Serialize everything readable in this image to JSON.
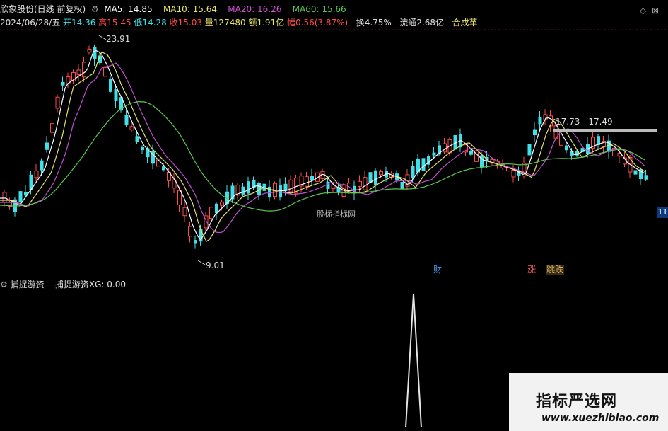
{
  "header": {
    "stock_title": "欣象股份(日线 前复权)",
    "ma5_label": "MA5: 14.85",
    "ma10_label": "MA10: 15.64",
    "ma20_label": "MA20: 16.26",
    "ma60_label": "MA60: 15.66",
    "date": "2024/06/28/五",
    "open": "开14.36",
    "high": "高15.45",
    "low": "低14.28",
    "close": "收15.03",
    "volume": "量127480",
    "amount": "额1.91亿",
    "change": "幅0.56(3.87%)",
    "turnover": "换4.75%",
    "float_cap": "流通2.68亿",
    "concept": "合成革"
  },
  "chart": {
    "peak_label": "23.91",
    "low_label": "9.01",
    "range_label": "17.73 - 17.49",
    "watermark_mid": "股标指标网",
    "tag_cai": "财",
    "tag_zhang": "涨",
    "tag_lidie": "跳跌",
    "right_edge_tag": "11"
  },
  "indicator": {
    "name": "捕捉游资",
    "series_label": "捕捉游资XG: 0.00"
  },
  "watermark": {
    "title": "指标严选网",
    "url": "www.xuezhibiao.com"
  },
  "colors": {
    "ma5": "#ffffff",
    "ma10": "#e8e36a",
    "ma20": "#c050d0",
    "ma60": "#5cc850",
    "up": "#ff4a4a",
    "down": "#40e0e8"
  },
  "icons": [
    "settings-icon",
    "window-icon",
    "close-icon"
  ]
}
